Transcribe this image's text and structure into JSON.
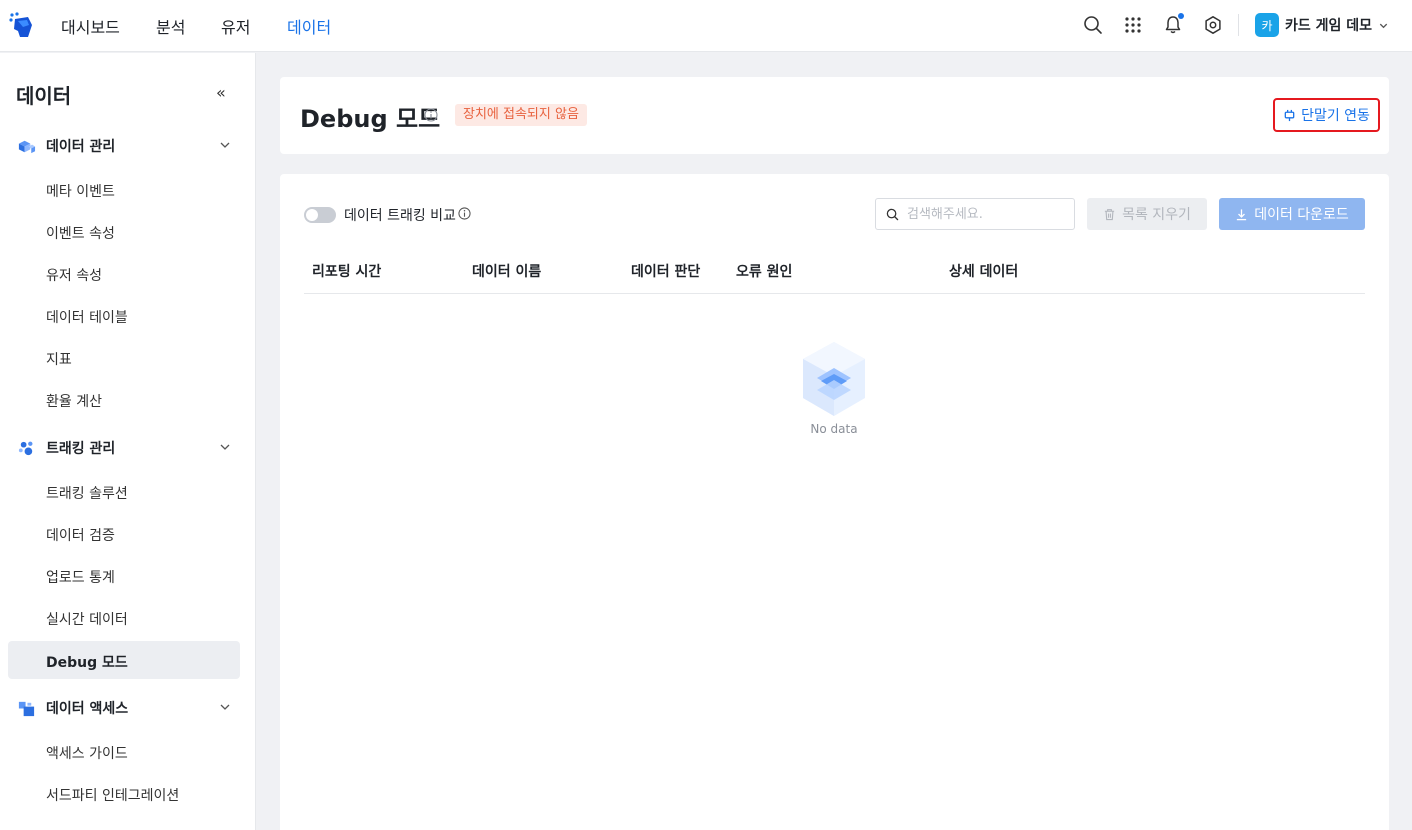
{
  "topnav": {
    "items": [
      {
        "label": "대시보드",
        "active": false
      },
      {
        "label": "분석",
        "active": false
      },
      {
        "label": "유저",
        "active": false
      },
      {
        "label": "데이터",
        "active": true
      }
    ],
    "icons": [
      "search-icon",
      "apps-grid-icon",
      "bell-icon",
      "gear-icon"
    ],
    "project": {
      "avatar": "카",
      "name": "카드 게임 데모"
    }
  },
  "sidebar": {
    "title": "데이터",
    "collapse_glyph": "«",
    "groups": [
      {
        "label": "데이터 관리",
        "icon": "cubes-icon",
        "items": [
          "메타 이벤트",
          "이벤트 속성",
          "유저 속성",
          "데이터 테이블",
          "지표",
          "환율 계산"
        ]
      },
      {
        "label": "트래킹 관리",
        "icon": "tracking-icon",
        "items": [
          "트래킹 솔루션",
          "데이터 검증",
          "업로드 통계",
          "실시간 데이터",
          "Debug 모드"
        ]
      },
      {
        "label": "데이터 액세스",
        "icon": "access-icon",
        "items": [
          "액세스 가이드",
          "서드파티 인테그레이션"
        ]
      }
    ],
    "active_item": "Debug 모드"
  },
  "header": {
    "title": "Debug 모드",
    "status_badge": "장치에 접속되지 않음",
    "connect_button": "단말기 연동"
  },
  "toolbar": {
    "compare_toggle_label": "데이터 트래킹 비교",
    "compare_toggle_on": false,
    "search_placeholder": "검색해주세요.",
    "clear_button": "목록 지우기",
    "download_button": "데이터 다운로드"
  },
  "table": {
    "columns": [
      "리포팅 시간",
      "데이터 이름",
      "데이터 판단",
      "오류 원인",
      "상세 데이터"
    ],
    "rows": [],
    "empty_text": "No data"
  },
  "colors": {
    "accent": "#1a73e8",
    "badge_bg": "#fde9e4",
    "badge_text": "#e8623f",
    "highlight_border": "#e5191f"
  }
}
